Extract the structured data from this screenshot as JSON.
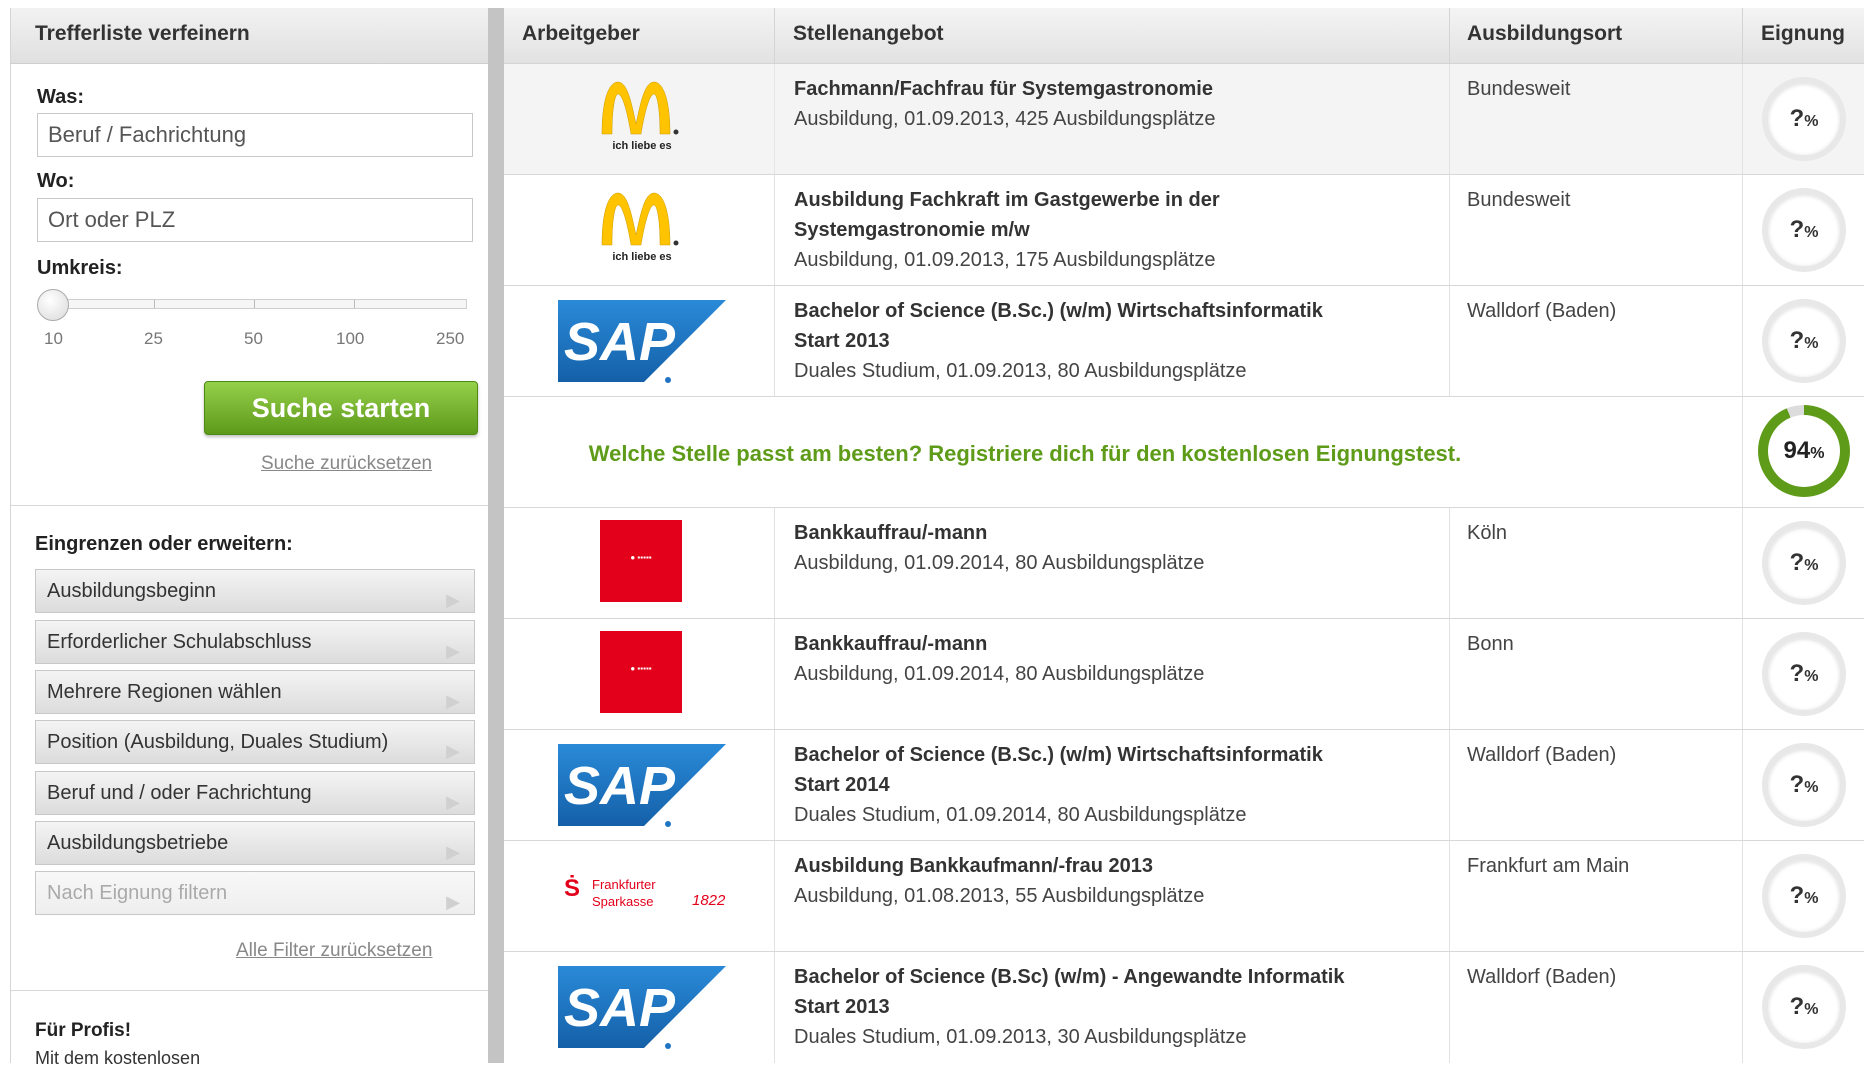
{
  "sidebar": {
    "title": "Trefferliste verfeinern",
    "what_label": "Was:",
    "what_placeholder": "Beruf / Fachrichtung",
    "where_label": "Wo:",
    "where_placeholder": "Ort oder PLZ",
    "radius_label": "Umkreis:",
    "radius_ticks": [
      "10",
      "25",
      "50",
      "100",
      "250"
    ],
    "radius_selected": "10",
    "search_button": "Suche starten",
    "reset_search": "Suche zurücksetzen",
    "filters_heading": "Eingrenzen oder erweitern:",
    "filters": [
      {
        "label": "Ausbildungsbeginn",
        "enabled": true
      },
      {
        "label": "Erforderlicher Schulabschluss",
        "enabled": true
      },
      {
        "label": "Mehrere Regionen wählen",
        "enabled": true
      },
      {
        "label": "Position (Ausbildung, Duales Studium)",
        "enabled": true
      },
      {
        "label": "Beruf und / oder Fachrichtung",
        "enabled": true
      },
      {
        "label": "Ausbildungsbetriebe",
        "enabled": true
      },
      {
        "label": "Nach Eignung filtern",
        "enabled": false
      }
    ],
    "reset_filters": "Alle Filter zurücksetzen",
    "pro_heading": "Für Profis!",
    "pro_text": "Mit dem kostenlosen"
  },
  "table": {
    "headers": {
      "employer": "Arbeitgeber",
      "offer": "Stellenangebot",
      "location": "Ausbildungsort",
      "fit": "Eignung"
    },
    "rows": [
      {
        "logo": "mcdonalds-logo",
        "title": "Fachmann/Fachfrau für Systemgastronomie",
        "title2": "",
        "detail": "Ausbildung, 01.09.2013, 425 Ausbildungsplätze",
        "location": "Bundesweit",
        "fit": "?"
      },
      {
        "logo": "mcdonalds-logo",
        "title": "Ausbildung Fachkraft im Gastgewerbe in der",
        "title2": "Systemgastronomie m/w",
        "detail": "Ausbildung, 01.09.2013, 175 Ausbildungsplätze",
        "location": "Bundesweit",
        "fit": "?"
      },
      {
        "logo": "sap-logo",
        "title": "Bachelor of Science (B.Sc.) (w/m) Wirtschaftsinformatik",
        "title2": "Start 2013",
        "detail": "Duales Studium, 01.09.2013, 80 Ausbildungsplätze",
        "location": "Walldorf (Baden)",
        "fit": "?"
      },
      {
        "logo": "sparkasse-koelnbonn-logo",
        "title": "Bankkauffrau/-mann",
        "title2": "",
        "detail": "Ausbildung, 01.09.2014, 80 Ausbildungsplätze",
        "location": "Köln",
        "fit": "?"
      },
      {
        "logo": "sparkasse-koelnbonn-logo",
        "title": "Bankkauffrau/-mann",
        "title2": "",
        "detail": "Ausbildung, 01.09.2014, 80 Ausbildungsplätze",
        "location": "Bonn",
        "fit": "?"
      },
      {
        "logo": "sap-logo",
        "title": "Bachelor of Science (B.Sc.) (w/m) Wirtschaftsinformatik",
        "title2": "Start 2014",
        "detail": "Duales Studium, 01.09.2014, 80 Ausbildungsplätze",
        "location": "Walldorf (Baden)",
        "fit": "?"
      },
      {
        "logo": "frankfurter-sparkasse-logo",
        "title": "Ausbildung Bankkaufmann/-frau 2013",
        "title2": "",
        "detail": "Ausbildung, 01.08.2013, 55 Ausbildungsplätze",
        "location": "Frankfurt am Main",
        "fit": "?"
      },
      {
        "logo": "sap-logo",
        "title": "Bachelor of Science (B.Sc) (w/m) - Angewandte Informatik",
        "title2": "Start 2013",
        "detail": "Duales Studium, 01.09.2013, 30 Ausbildungsplätze",
        "location": "Walldorf (Baden)",
        "fit": "?"
      }
    ],
    "promo": {
      "text": "Welche Stelle passt am besten? Registriere dich für den kostenlosen Eignungstest.",
      "fit_value": "94",
      "fit_fraction": 0.94
    },
    "percent_sign": "%"
  },
  "logos": {
    "mcdonalds_tagline": "ich liebe es",
    "sap_text": "SAP",
    "frankfurter_line1": "Frankfurter",
    "frankfurter_line2": "Sparkasse",
    "frankfurter_year": "1822"
  },
  "colors": {
    "accent_green": "#5e9b19",
    "button_green_top": "#95d04a",
    "button_green_bottom": "#5d9a1a",
    "mcdonalds_yellow": "#ffc300",
    "sap_blue": "#1f74c4",
    "sparkasse_red": "#e2001a"
  }
}
